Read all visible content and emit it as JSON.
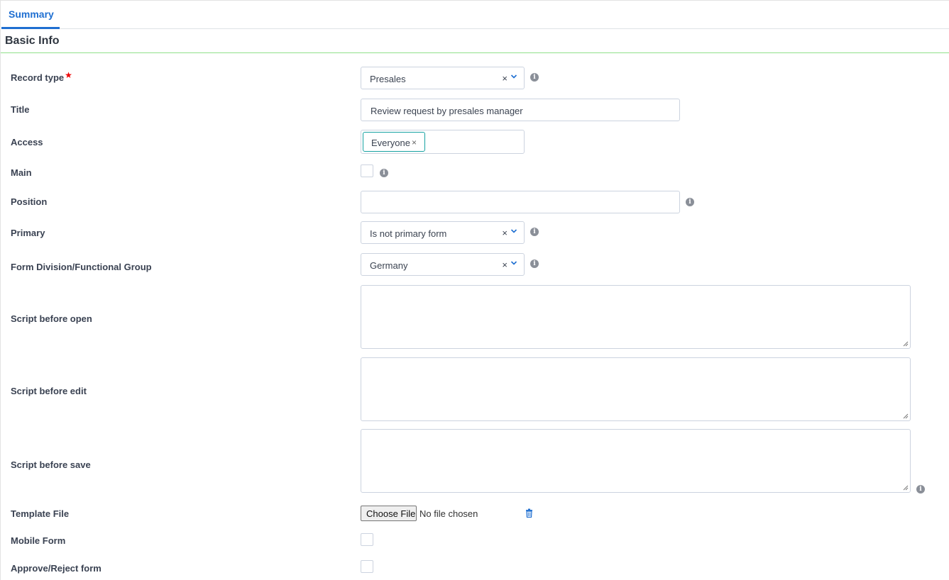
{
  "tabs": [
    {
      "label": "Summary",
      "active": true
    }
  ],
  "section": {
    "title": "Basic Info"
  },
  "fields": {
    "record_type": {
      "label": "Record type",
      "required_mark": "★",
      "value": "Presales",
      "clear": "×"
    },
    "title": {
      "label": "Title",
      "value": "Review request by presales manager"
    },
    "access": {
      "label": "Access",
      "tags": [
        {
          "label": "Everyone",
          "remove": "×"
        }
      ]
    },
    "main": {
      "label": "Main",
      "checked": false
    },
    "position": {
      "label": "Position",
      "value": ""
    },
    "primary": {
      "label": "Primary",
      "value": "Is not primary form",
      "clear": "×"
    },
    "form_division": {
      "label": "Form Division/Functional Group",
      "value": "Germany",
      "clear": "×"
    },
    "script_before_open": {
      "label": "Script before open",
      "value": ""
    },
    "script_before_edit": {
      "label": "Script before edit",
      "value": ""
    },
    "script_before_save": {
      "label": "Script before save",
      "value": ""
    },
    "template_file": {
      "label": "Template File",
      "button": "Choose File",
      "status": "No file chosen"
    },
    "mobile_form": {
      "label": "Mobile Form",
      "checked": false
    },
    "approve_reject_form": {
      "label": "Approve/Reject form",
      "checked": false
    }
  },
  "icons": {
    "info": "i"
  },
  "colors": {
    "accent": "#1f6fd1",
    "section_line": "#90e08a",
    "tag_border": "#17a2a2",
    "required": "#ee0000"
  }
}
